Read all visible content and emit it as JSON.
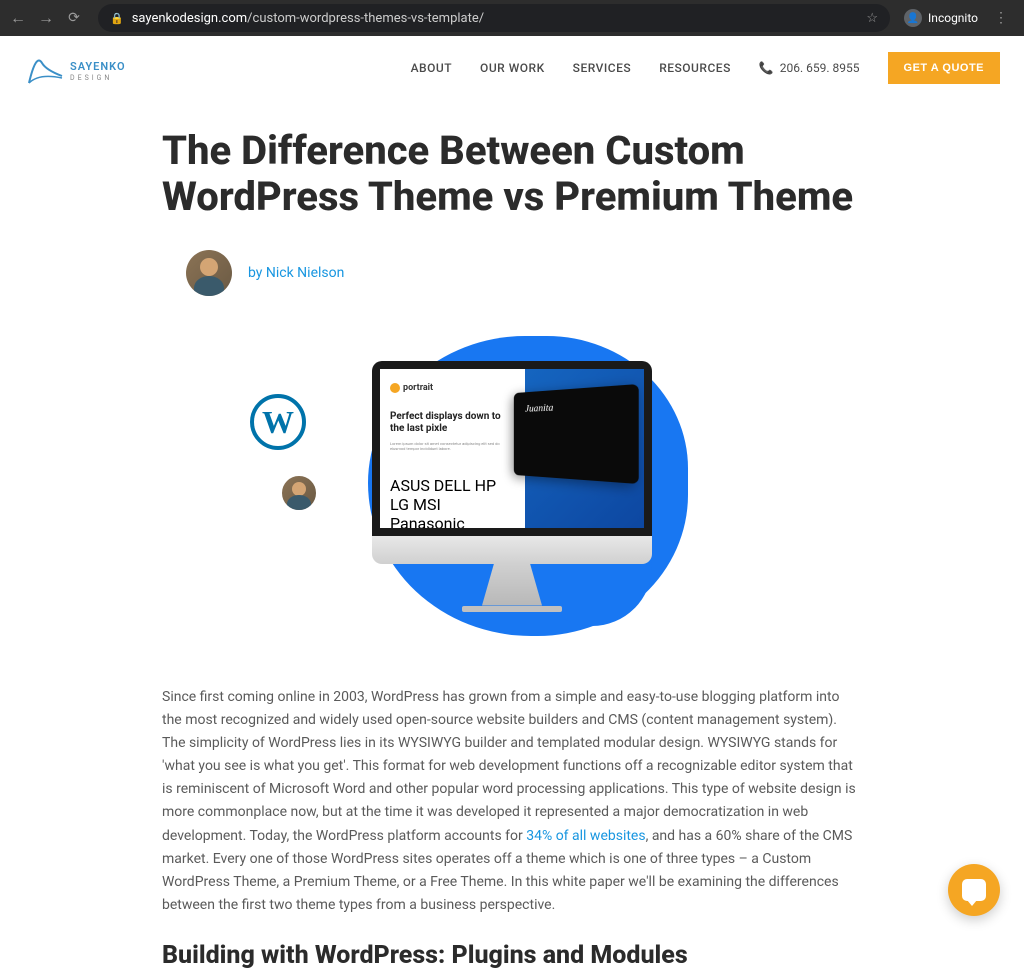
{
  "browser": {
    "url_domain": "sayenkodesign.com",
    "url_path": "/custom-wordpress-themes-vs-template/",
    "incognito_label": "Incognito"
  },
  "header": {
    "logo_main": "SAYENKO",
    "logo_sub": "DESIGN",
    "nav": {
      "about": "ABOUT",
      "our_work": "OUR WORK",
      "services": "SERVICES",
      "resources": "RESOURCES"
    },
    "phone": "206. 659. 8955",
    "quote_btn": "GET A QUOTE"
  },
  "article": {
    "title": "The Difference Between Custom WordPress Theme vs Premium Theme",
    "byline": "by Nick Nielson",
    "hero": {
      "wp_letter": "W",
      "screen_brand": "portrait",
      "screen_headline": "Perfect displays down to the last pixle",
      "screen_logos": "ASUS  DELL  HP  LG  MSI  Panasonic",
      "curved_text": "Juanita"
    },
    "para_before_link": "Since first coming online in 2003, WordPress has grown from a simple and easy-to-use blogging platform into the most recognized and widely used open-source website builders and CMS (content management system). The simplicity of WordPress lies in its WYSIWYG builder and templated modular design. WYSIWYG stands for 'what you see is what you get'. This format for web development functions off a recognizable editor system that is reminiscent of Microsoft Word and other popular word processing applications. This type of website design is more commonplace now, but at the time it was developed it represented a major democratization in web development. Today, the WordPress platform accounts for ",
    "link_text": "34% of all websites",
    "para_after_link": ", and has a 60% share of the CMS market. Every one of those WordPress sites operates off a theme which is one of three types – a Custom WordPress Theme, a Premium Theme, or a Free Theme. In this white paper we'll be examining the differences between the first two theme types from a business perspective.",
    "h2": "Building with WordPress: Plugins and Modules"
  }
}
